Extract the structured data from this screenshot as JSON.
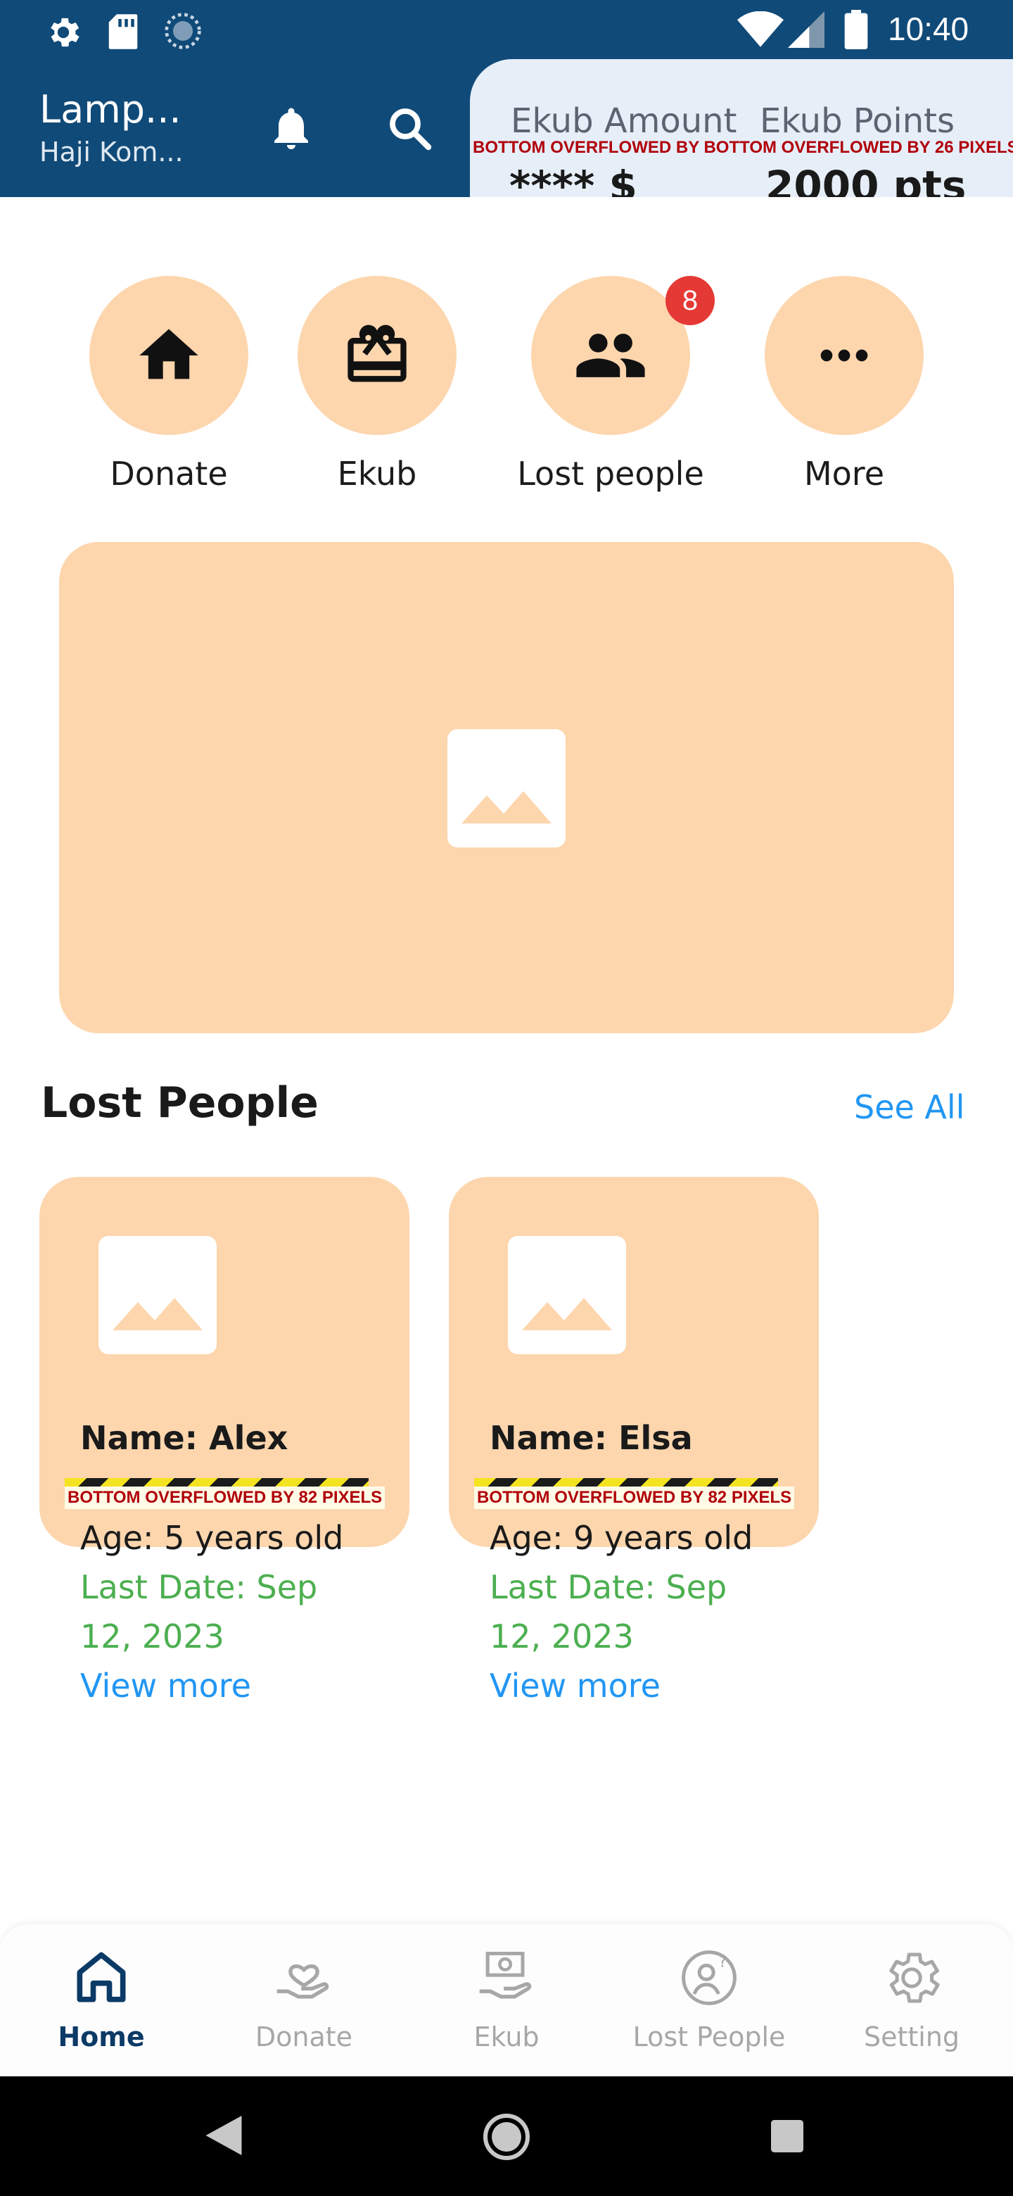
{
  "status_bar": {
    "time": "10:40",
    "icons": [
      "gear-icon",
      "sd-card-icon",
      "sync-icon",
      "wifi-icon",
      "signal-icon",
      "battery-icon"
    ]
  },
  "header": {
    "title": "Lamp...",
    "subtitle": "Haji Kom...",
    "icons": [
      "bell-icon",
      "search-icon"
    ]
  },
  "ekub_card": {
    "amount_label": "Ekub Amount",
    "points_label": "Ekub Points",
    "amount_value": "**** $",
    "points_value": "2000 pts",
    "overflow_text": "BOTTOM OVERFLOWED BY BOTTOM OVERFLOWED BY 26 PIXELS"
  },
  "quick_actions": [
    {
      "label": "Donate",
      "icon": "home-icon"
    },
    {
      "label": "Ekub",
      "icon": "gift-card-icon"
    },
    {
      "label": "Lost people",
      "icon": "people-icon",
      "badge": "8"
    },
    {
      "label": "More",
      "icon": "more-icon"
    }
  ],
  "banner": {
    "icon": "image-placeholder-icon"
  },
  "lost_people": {
    "title": "Lost People",
    "see_all": "See All",
    "overflow_label": "BOTTOM OVERFLOWED BY 82 PIXELS",
    "cards": [
      {
        "name": "Name: Alex",
        "age": "Age: 5 years old",
        "last_date_1": "Last Date: Sep",
        "last_date_2": "12, 2023",
        "view_more": "View more"
      },
      {
        "name": "Name: Elsa",
        "age": "Age: 9 years old",
        "last_date_1": "Last Date: Sep",
        "last_date_2": "12, 2023",
        "view_more": "View more"
      }
    ]
  },
  "bottom_nav": {
    "active": "Home",
    "items": [
      {
        "label": "Home",
        "icon": "home-outline-icon"
      },
      {
        "label": "Donate",
        "icon": "donate-hand-icon"
      },
      {
        "label": "Ekub",
        "icon": "money-hand-icon"
      },
      {
        "label": "Lost People",
        "icon": "lost-person-icon"
      },
      {
        "label": "Setting",
        "icon": "settings-gear-icon"
      }
    ]
  },
  "colors": {
    "header_bg": "#104a78",
    "accent_peach": "#fdd6ae",
    "link_blue": "#2196f3",
    "green": "#4caf50",
    "badge_red": "#e53935",
    "nav_active": "#0c3a66"
  }
}
